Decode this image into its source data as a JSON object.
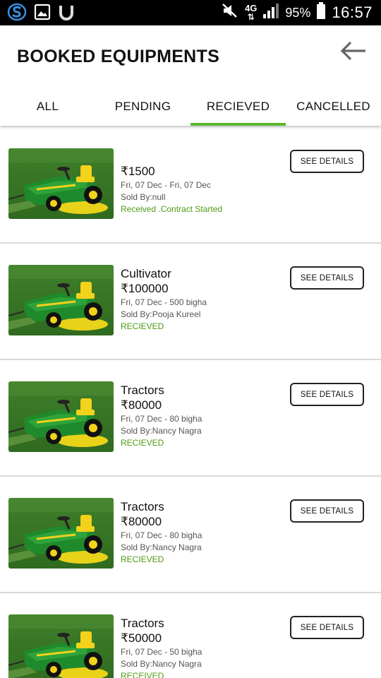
{
  "status_bar": {
    "network": "4G",
    "battery": "95%",
    "time": "16:57",
    "icons": [
      "app-s-icon",
      "gallery-icon",
      "u-app-icon",
      "mute-icon",
      "signal-icon",
      "battery-icon"
    ]
  },
  "header": {
    "title": "BOOKED EQUIPMENTS",
    "back_icon": "back-arrow-icon"
  },
  "tabs": [
    {
      "label": "ALL",
      "active": false
    },
    {
      "label": "PENDING",
      "active": false
    },
    {
      "label": "RECIEVED",
      "active": true
    },
    {
      "label": "CANCELLED",
      "active": false
    }
  ],
  "accent_color": "#5cb82e",
  "status_color": "#4f9a12",
  "items": [
    {
      "name": "",
      "price": "₹1500",
      "dates": "Fri, 07 Dec - Fri, 07 Dec",
      "seller": "Sold By:null",
      "status": "Received .Contract Started",
      "button": "SEE DETAILS"
    },
    {
      "name": "Cultivator",
      "price": "₹100000",
      "dates": "Fri, 07 Dec - 500 bigha",
      "seller": "Sold By:Pooja Kureel",
      "status": "RECIEVED",
      "button": "SEE DETAILS"
    },
    {
      "name": "Tractors",
      "price": "₹80000",
      "dates": "Fri, 07 Dec - 80 bigha",
      "seller": "Sold By:Nancy Nagra",
      "status": "RECIEVED",
      "button": "SEE DETAILS"
    },
    {
      "name": "Tractors",
      "price": "₹80000",
      "dates": "Fri, 07 Dec - 80 bigha",
      "seller": "Sold By:Nancy Nagra",
      "status": "RECIEVED",
      "button": "SEE DETAILS"
    },
    {
      "name": "Tractors",
      "price": "₹50000",
      "dates": "Fri, 07 Dec - 50 bigha",
      "seller": "Sold By:Nancy Nagra",
      "status": "RECEIVED",
      "button": "SEE DETAILS"
    }
  ]
}
